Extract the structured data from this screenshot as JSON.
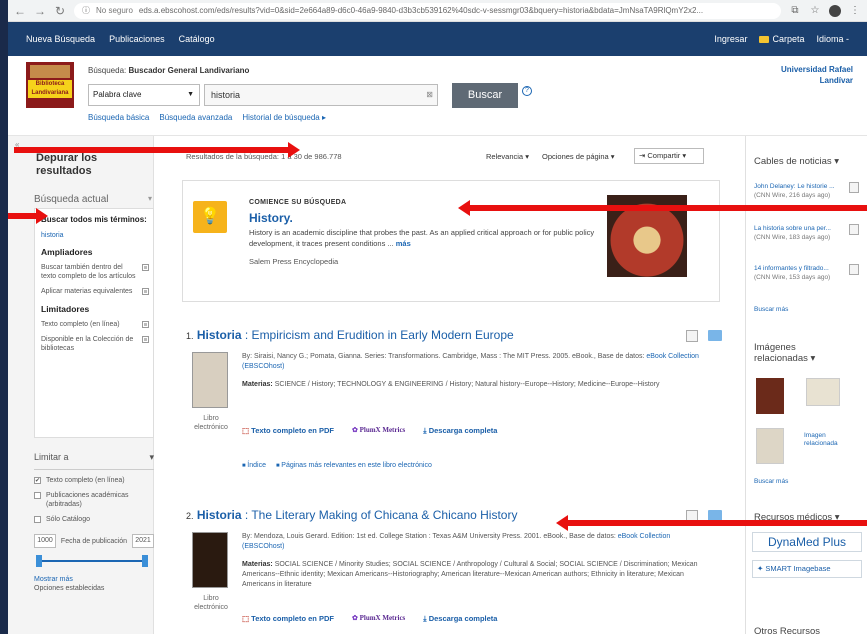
{
  "browser": {
    "insecure": "No seguro",
    "url": "eds.a.ebscohost.com/eds/results?vid=0&sid=2e664a89-d6c0-46a9-9840-d3b3cb539162%40sdc-v-sessmgr03&bquery=historia&bdata=JmNsaTA9RlQmY2x2..."
  },
  "topnav": {
    "left": [
      "Nueva Búsqueda",
      "Publicaciones",
      "Catálogo"
    ],
    "right": [
      "Ingresar",
      "Carpeta",
      "Idioma -"
    ]
  },
  "header": {
    "logo_text": "Biblioteca Landivariana",
    "search_label_prefix": "Búsqueda:",
    "search_label": "Buscador General Landivariano",
    "field_select": "Palabra clave",
    "query": "historia",
    "search_button": "Buscar",
    "links": [
      "Búsqueda básica",
      "Búsqueda avanzada",
      "Historial de búsqueda ▸"
    ],
    "institution_line1": "Universidad Rafael",
    "institution_line2": "Landívar"
  },
  "left": {
    "title": "Depurar los resultados",
    "current_search": "Búsqueda actual",
    "find_all": "Buscar todos mis términos:",
    "term": "historia",
    "expanders_title": "Ampliadores",
    "expanders": [
      "Buscar también dentro del texto completo de los artículos",
      "Aplicar materias equivalentes"
    ],
    "limiters_title": "Limitadores",
    "limiters": [
      "Texto completo (en línea)",
      "Disponible en la Colección de bibliotecas"
    ],
    "limit_to": "Limitar a",
    "limit_options": [
      "Texto completo (en línea)",
      "Publicaciones académicas (arbitradas)",
      "Sólo Catálogo"
    ],
    "date_from": "1000",
    "date_label": "Fecha de publicación",
    "date_to": "2021",
    "show_more": "Mostrar más",
    "options_set": "Opciones establecidas"
  },
  "toolbar": {
    "count": "Resultados de la búsqueda: 1 a 30 de 986.778",
    "sort": "Relevancia ▾",
    "page_options": "Opciones de página ▾",
    "share": "Compartir ▾"
  },
  "placard": {
    "kicker": "COMIENCE SU BÚSQUEDA",
    "title": "History.",
    "desc": "History is an academic discipline that probes the past. As an applied critical approach or for public policy development, it traces present conditions ...",
    "more": "más",
    "source": "Salem Press Encyclopedia"
  },
  "results": [
    {
      "num": "1.",
      "title_bold": "Historia",
      "title_rest": ": Empiricism and Erudition in Early Modern Europe",
      "byline": "By: Siraisi, Nancy G.; Pomata, Gianna. Series: Transformations. Cambridge, Mass : The MIT Press. 2005. eBook., Base de datos:",
      "db": "eBook Collection (EBSCOhost)",
      "subjects_label": "Materias:",
      "subjects": "SCIENCE / History; TECHNOLOGY & ENGINEERING / History; Natural history--Europe--History; Medicine--Europe--History",
      "type": "Libro electrónico",
      "links": [
        "Texto completo en PDF",
        "PlumX Metrics",
        "Descarga completa"
      ],
      "sublinks": [
        "Índice",
        "Páginas más relevantes en este libro electrónico"
      ]
    },
    {
      "num": "2.",
      "title_bold": "Historia",
      "title_rest": ": The Literary Making of Chicana & Chicano History",
      "byline": "By: Mendoza, Louis Gerard. Edition: 1st ed. College Station : Texas A&M University Press. 2001. eBook., Base de datos:",
      "db": "eBook Collection (EBSCOhost)",
      "subjects_label": "Materias:",
      "subjects": "SOCIAL SCIENCE / Minority Studies; SOCIAL SCIENCE / Anthropology / Cultural & Social; SOCIAL SCIENCE / Discrimination; Mexican Americans--Ethnic identity; Mexican Americans--Historiography; American literature--Mexican American authors; Ethnicity in literature; Mexican Americans in literature",
      "type": "Libro electrónico",
      "links": [
        "Texto completo en PDF",
        "PlumX Metrics",
        "Descarga completa"
      ]
    }
  ],
  "right": {
    "news_title": "Cables de noticias ▾",
    "news": [
      {
        "text": "John Delaney: Le historie ...",
        "meta": "(CNN Wire, 216 days ago)"
      },
      {
        "text": "La historia sobre una per...",
        "meta": "(CNN Wire, 183 days ago)"
      },
      {
        "text": "14 informantes y filtrado...",
        "meta": "(CNN Wire, 153 days ago)"
      }
    ],
    "search_more": "Buscar más",
    "images_title": "Imágenes relacionadas ▾",
    "image_alt": "Imagen relacionada",
    "search_more2": "Buscar más",
    "medical_title": "Recursos médicos ▾",
    "dynamed": "DynaMed Plus",
    "smart": "SMART Imagebase",
    "other": "Otros Recursos"
  },
  "colors": {
    "nav": "#1b3f6e",
    "link": "#1b5fa8",
    "arrow": "#e8100f",
    "accent": "#f6b31b"
  }
}
